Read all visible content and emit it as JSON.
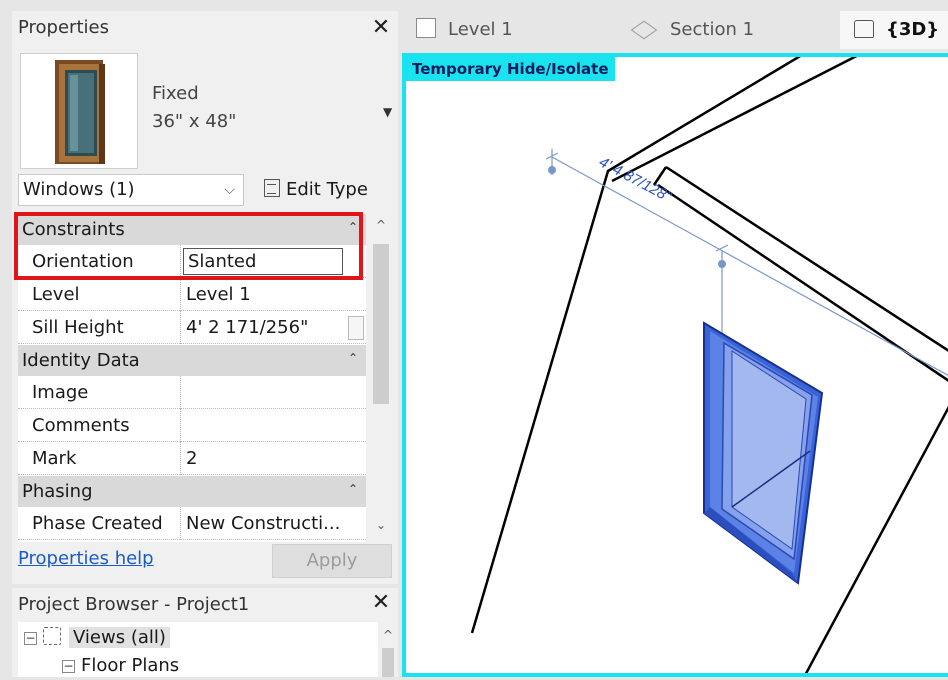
{
  "properties": {
    "title": "Properties",
    "type_name": "Fixed",
    "type_size": "36\" x 48\"",
    "instance_selector": "Windows (1)",
    "edit_type_label": "Edit Type",
    "groups": {
      "constraints": "Constraints",
      "identity": "Identity Data",
      "phasing": "Phasing"
    },
    "rows": {
      "orientation": {
        "label": "Orientation",
        "value": "Slanted"
      },
      "level": {
        "label": "Level",
        "value": "Level 1"
      },
      "sill_height": {
        "label": "Sill Height",
        "value": "4'  2 171/256\""
      },
      "image": {
        "label": "Image",
        "value": ""
      },
      "comments": {
        "label": "Comments",
        "value": ""
      },
      "mark": {
        "label": "Mark",
        "value": "2"
      },
      "phase_created": {
        "label": "Phase Created",
        "value": "New Constructi..."
      }
    },
    "help_link": "Properties help",
    "apply_label": "Apply"
  },
  "browser": {
    "title": "Project Browser - Project1",
    "nodes": {
      "views": "Views (all)",
      "floor_plans": "Floor Plans"
    }
  },
  "tabs": {
    "level1": "Level 1",
    "section1": "Section 1",
    "view3d": "{3D}"
  },
  "viewport": {
    "temp_label": "Temporary Hide/Isolate",
    "dimension_text": "4'  4 87/128\""
  },
  "colors": {
    "highlight": "#e0151a",
    "cyan_border": "#19e3ee",
    "window_fill": "#6f8fe8",
    "link": "#1a5cc7"
  }
}
